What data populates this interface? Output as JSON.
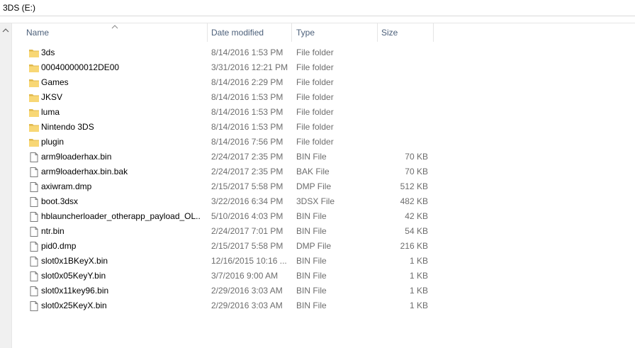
{
  "address": {
    "path": "3DS (E:)"
  },
  "columns": {
    "name": "Name",
    "date_modified": "Date modified",
    "type": "Type",
    "size": "Size"
  },
  "sort": {
    "column": "name",
    "direction": "ascending"
  },
  "files": [
    {
      "icon": "folder-icon",
      "name": "3ds",
      "date": "8/14/2016 1:53 PM",
      "type": "File folder",
      "size": ""
    },
    {
      "icon": "folder-icon",
      "name": "000400000012DE00",
      "date": "3/31/2016 12:21 PM",
      "type": "File folder",
      "size": ""
    },
    {
      "icon": "folder-icon",
      "name": "Games",
      "date": "8/14/2016 2:29 PM",
      "type": "File folder",
      "size": ""
    },
    {
      "icon": "folder-icon",
      "name": "JKSV",
      "date": "8/14/2016 1:53 PM",
      "type": "File folder",
      "size": ""
    },
    {
      "icon": "folder-icon",
      "name": "luma",
      "date": "8/14/2016 1:53 PM",
      "type": "File folder",
      "size": ""
    },
    {
      "icon": "folder-icon",
      "name": "Nintendo 3DS",
      "date": "8/14/2016 1:53 PM",
      "type": "File folder",
      "size": ""
    },
    {
      "icon": "folder-icon",
      "name": "plugin",
      "date": "8/14/2016 7:56 PM",
      "type": "File folder",
      "size": ""
    },
    {
      "icon": "file-icon",
      "name": "arm9loaderhax.bin",
      "date": "2/24/2017 2:35 PM",
      "type": "BIN File",
      "size": "70 KB"
    },
    {
      "icon": "file-icon",
      "name": "arm9loaderhax.bin.bak",
      "date": "2/24/2017 2:35 PM",
      "type": "BAK File",
      "size": "70 KB"
    },
    {
      "icon": "file-icon",
      "name": "axiwram.dmp",
      "date": "2/15/2017 5:58 PM",
      "type": "DMP File",
      "size": "512 KB"
    },
    {
      "icon": "file-icon",
      "name": "boot.3dsx",
      "date": "3/22/2016 6:34 PM",
      "type": "3DSX File",
      "size": "482 KB"
    },
    {
      "icon": "file-icon",
      "name": "hblauncherloader_otherapp_payload_OL...",
      "date": "5/10/2016 4:03 PM",
      "type": "BIN File",
      "size": "42 KB"
    },
    {
      "icon": "file-icon",
      "name": "ntr.bin",
      "date": "2/24/2017 7:01 PM",
      "type": "BIN File",
      "size": "54 KB"
    },
    {
      "icon": "file-icon",
      "name": "pid0.dmp",
      "date": "2/15/2017 5:58 PM",
      "type": "DMP File",
      "size": "216 KB"
    },
    {
      "icon": "file-icon",
      "name": "slot0x1BKeyX.bin",
      "date": "12/16/2015 10:16 ...",
      "type": "BIN File",
      "size": "1 KB"
    },
    {
      "icon": "file-icon",
      "name": "slot0x05KeyY.bin",
      "date": "3/7/2016 9:00 AM",
      "type": "BIN File",
      "size": "1 KB"
    },
    {
      "icon": "file-icon",
      "name": "slot0x11key96.bin",
      "date": "2/29/2016 3:03 AM",
      "type": "BIN File",
      "size": "1 KB"
    },
    {
      "icon": "file-icon",
      "name": "slot0x25KeyX.bin",
      "date": "2/29/2016 3:03 AM",
      "type": "BIN File",
      "size": "1 KB"
    }
  ],
  "colors": {
    "folder": "#f8d775",
    "folder_dark": "#e0b94d",
    "header_text": "#4c607a",
    "secondary_text": "#6d6d6d"
  }
}
